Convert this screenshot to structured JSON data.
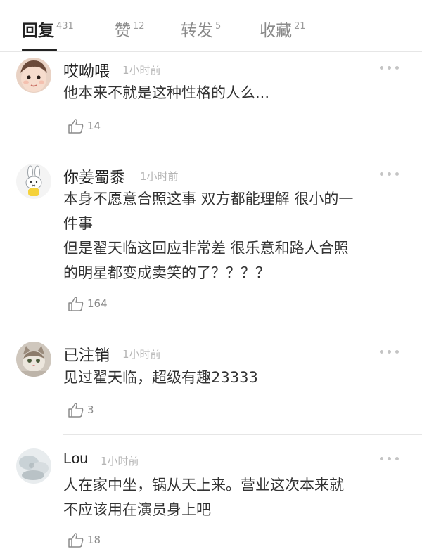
{
  "tabs": [
    {
      "label": "回复",
      "count": "431"
    },
    {
      "label": "赞",
      "count": "12"
    },
    {
      "label": "转发",
      "count": "5"
    },
    {
      "label": "收藏",
      "count": "21"
    }
  ],
  "comments": [
    {
      "name": "哎呦喂",
      "time": "1小时前",
      "lines": [
        "他本来不就是这种性格的人么..."
      ],
      "likes": "14",
      "avatar": "baby-face-avatar"
    },
    {
      "name": "你姜蜀黍",
      "time": "1小时前",
      "lines": [
        "本身不愿意合照这事  双方都能理解  很小的一",
        "件事",
        "但是翟天临这回应非常差  很乐意和路人合照",
        "的明星都变成卖笑的了？？？？"
      ],
      "likes": "164",
      "avatar": "bunny-avatar"
    },
    {
      "name": "已注销",
      "time": "1小时前",
      "lines": [
        "见过翟天临，超级有趣23333"
      ],
      "likes": "3",
      "avatar": "cat-avatar"
    },
    {
      "name": "Lou",
      "time": "1小时前",
      "lines": [
        "人在家中坐，锅从天上来。营业这次本来就",
        "不应该用在演员身上吧"
      ],
      "likes": "18",
      "avatar": "blurred-photo-avatar"
    }
  ],
  "colors": {
    "text": "#222222",
    "muted": "#8a8a8a",
    "divider": "#e6e6e6"
  }
}
